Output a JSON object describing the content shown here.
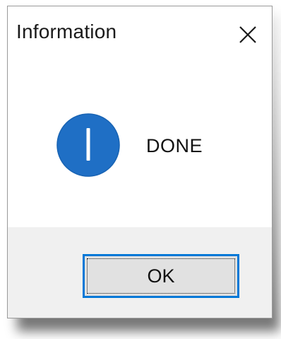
{
  "dialog": {
    "title": "Information",
    "close_icon": "close-icon",
    "icon": "information-icon",
    "message": "DONE",
    "ok_label": "OK"
  },
  "colors": {
    "accent": "#0078d7",
    "icon_fill": "#1f6fc5",
    "footer_bg": "#f0f0f0",
    "button_bg": "#e1e1e1"
  }
}
